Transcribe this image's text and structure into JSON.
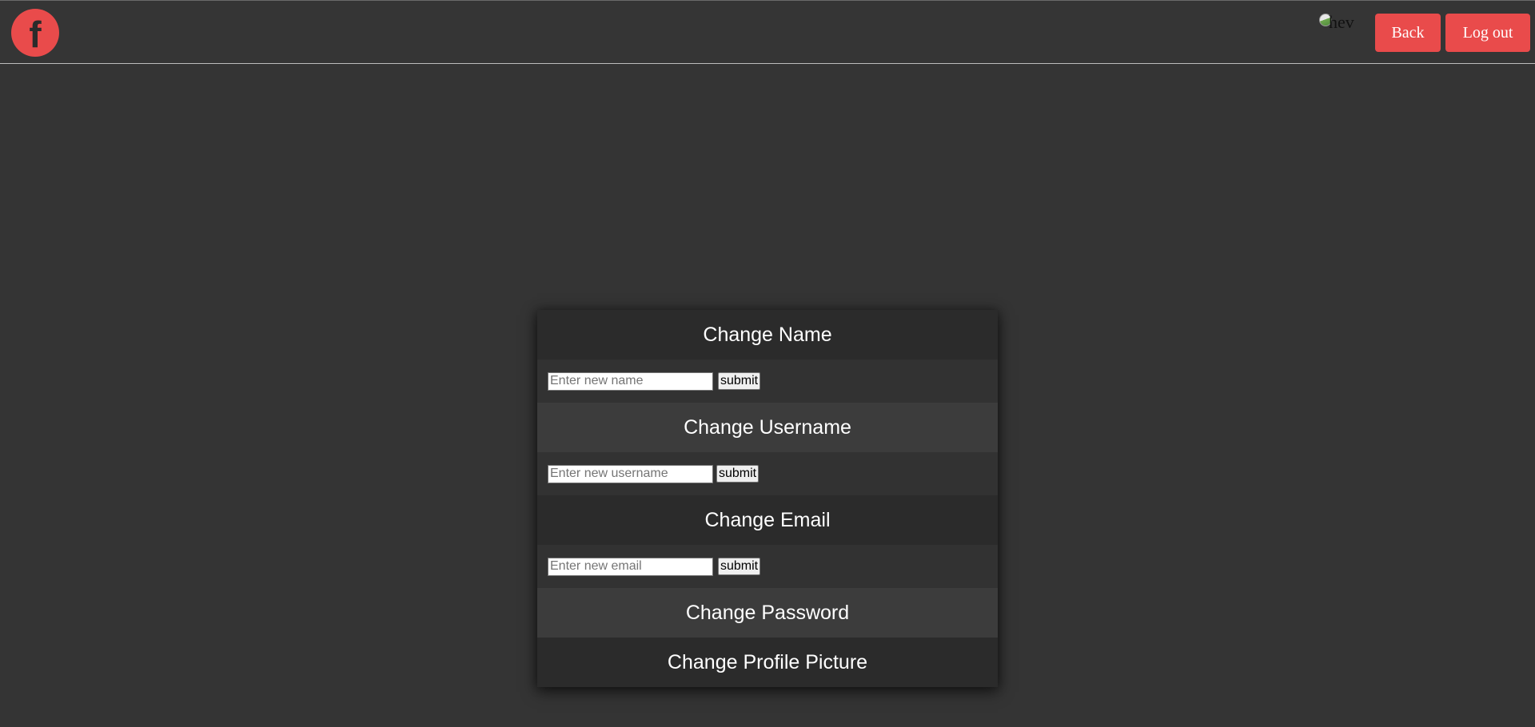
{
  "header": {
    "logo_letter": "f",
    "broken_image_alt": "hev",
    "back_label": "Back",
    "logout_label": "Log out"
  },
  "colors": {
    "accent": "#e94b4b",
    "background": "#343434"
  },
  "settings": {
    "change_name": {
      "title": "Change Name",
      "placeholder": "Enter new name",
      "value": "",
      "submit_label": "submit"
    },
    "change_username": {
      "title": "Change Username",
      "placeholder": "Enter new username",
      "value": "",
      "submit_label": "submit"
    },
    "change_email": {
      "title": "Change Email",
      "placeholder": "Enter new email",
      "value": "",
      "submit_label": "submit"
    },
    "change_password": {
      "title": "Change Password"
    },
    "change_profile_picture": {
      "title": "Change Profile Picture"
    }
  }
}
